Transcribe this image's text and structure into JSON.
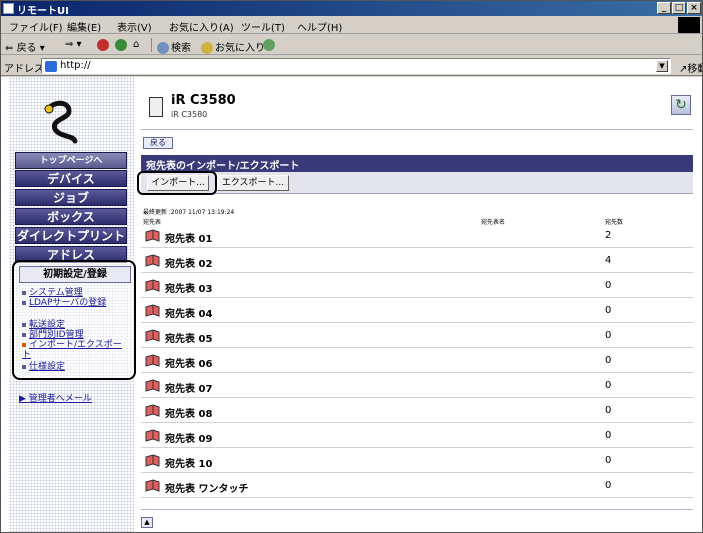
{
  "window": {
    "title": "リモートUI"
  },
  "titlebar": {
    "min": "_",
    "max": "□",
    "close": "×"
  },
  "menu": [
    "ファイル(F)",
    "編集(E)",
    "表示(V)",
    "お気に入り(A)",
    "ツール(T)",
    "ヘルプ(H)"
  ],
  "toolbar": {
    "back": "戻る",
    "search": "検索",
    "favorites": "お気に入り"
  },
  "address": {
    "label": "アドレス(D)",
    "url": "http://",
    "go": "移動"
  },
  "sidebar": {
    "top_page": "トップページへ",
    "nav": [
      "デバイス",
      "ジョブ",
      "ボックス",
      "ダイレクトプリント",
      "アドレス"
    ],
    "settings_head": "初期設定/登録",
    "links": [
      "システム管理",
      "LDAPサーバの登録",
      "転送設定",
      "部門別ID管理",
      "インポート/エクスポート",
      "仕様設定"
    ],
    "admin_mail": "管理者へメール"
  },
  "device": {
    "name": "iR C3580",
    "model": "iR C3580"
  },
  "back_label": "戻る",
  "section": {
    "title": "宛先表のインポート/エクスポート"
  },
  "buttons": {
    "import": "インポート...",
    "export": "エクスポート..."
  },
  "last_updated": "最終更新 :2007 11/07 13:19:24",
  "columns": {
    "name": "宛先表",
    "list_name": "宛先表名",
    "count": "宛先数"
  },
  "rows": [
    {
      "name": "宛先表 01",
      "count": "2"
    },
    {
      "name": "宛先表 02",
      "count": "4"
    },
    {
      "name": "宛先表 03",
      "count": "0"
    },
    {
      "name": "宛先表 04",
      "count": "0"
    },
    {
      "name": "宛先表 05",
      "count": "0"
    },
    {
      "name": "宛先表 06",
      "count": "0"
    },
    {
      "name": "宛先表 07",
      "count": "0"
    },
    {
      "name": "宛先表 08",
      "count": "0"
    },
    {
      "name": "宛先表 09",
      "count": "0"
    },
    {
      "name": "宛先表 10",
      "count": "0"
    },
    {
      "name": "宛先表 ワンタッチ",
      "count": "0"
    }
  ],
  "icons": {
    "window": "ie-icon",
    "logo": "remote-ui-logo",
    "refresh": "refresh-icon",
    "device": "printer-icon",
    "row": "address-book-icon",
    "scroll_top": "up-arrow-icon"
  },
  "colors": {
    "nav": "#2e2e6e",
    "section": "#3a3a7a",
    "link": "#1a1a9a",
    "active_bullet": "#e05a00"
  }
}
